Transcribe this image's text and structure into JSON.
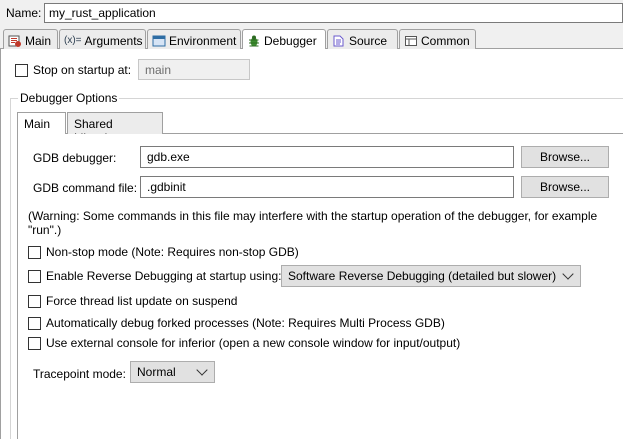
{
  "name_row": {
    "label": "Name:",
    "value": "my_rust_application"
  },
  "tabs": [
    {
      "label": "Main",
      "icon": "main-config-icon"
    },
    {
      "label": "Arguments",
      "icon": "arguments-icon",
      "icon_text": "(x)="
    },
    {
      "label": "Environment",
      "icon": "environment-icon"
    },
    {
      "label": "Debugger",
      "icon": "debugger-bug-icon",
      "active": true
    },
    {
      "label": "Source",
      "icon": "source-icon"
    },
    {
      "label": "Common",
      "icon": "common-icon"
    }
  ],
  "stop_on_startup": {
    "label": "Stop on startup at:",
    "checked": false,
    "value": "main"
  },
  "debugger_options": {
    "title": "Debugger Options",
    "subtabs": [
      {
        "label": "Main",
        "active": true
      },
      {
        "label": "Shared Libraries"
      }
    ],
    "gdb_debugger": {
      "label": "GDB debugger:",
      "value": "gdb.exe",
      "browse_label": "Browse..."
    },
    "gdb_command_file": {
      "label": "GDB command file:",
      "value": ".gdbinit",
      "browse_label": "Browse..."
    },
    "warning_line1": "(Warning: Some commands in this file may interfere with the startup operation of the debugger, for example",
    "warning_line2": "\"run\".)",
    "non_stop": {
      "label": "Non-stop mode (Note: Requires non-stop GDB)",
      "checked": false
    },
    "reverse_debugging": {
      "label": "Enable Reverse Debugging at startup using:",
      "checked": false,
      "selected": "Software Reverse Debugging (detailed but slower)"
    },
    "force_thread": {
      "label": "Force thread list update on suspend",
      "checked": false
    },
    "auto_debug_forked": {
      "label": "Automatically debug forked processes (Note: Requires Multi Process GDB)",
      "checked": false
    },
    "external_console": {
      "label": "Use external console for inferior (open a new console window for input/output)",
      "checked": false
    },
    "tracepoint_mode": {
      "label": "Tracepoint mode:",
      "selected": "Normal"
    }
  },
  "colors": {
    "main_icon_red": "#c0392b",
    "arguments_icon": "#2c3e50",
    "environment_icon": "#2e6da4",
    "debugger_icon_green": "#3c8d2f",
    "source_icon": "#6a5acd",
    "common_icon": "#555555"
  }
}
